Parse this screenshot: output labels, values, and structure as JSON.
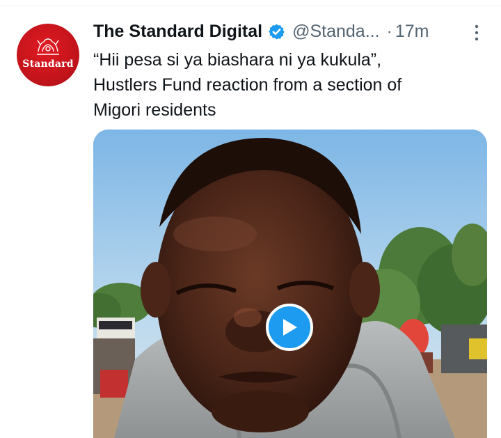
{
  "account": {
    "display_name": "The Standard Digital",
    "handle": "@Standa...",
    "separator": "·",
    "time": "17m",
    "avatar_text": "Standard",
    "verified": true
  },
  "tweet": {
    "lines": [
      "“Hii pesa si ya biashara ni ya kukula”,",
      "Hustlers Fund reaction from a section of",
      "Migori residents"
    ]
  },
  "media": {
    "type": "video",
    "play_icon": "play-icon"
  },
  "icons": {
    "verified": "verified-badge-icon",
    "more": "more-options-icon"
  },
  "colors": {
    "brand_red": "#c4141b",
    "verified_blue": "#1d9bf0",
    "text_primary": "#0f1419",
    "text_secondary": "#536471"
  }
}
